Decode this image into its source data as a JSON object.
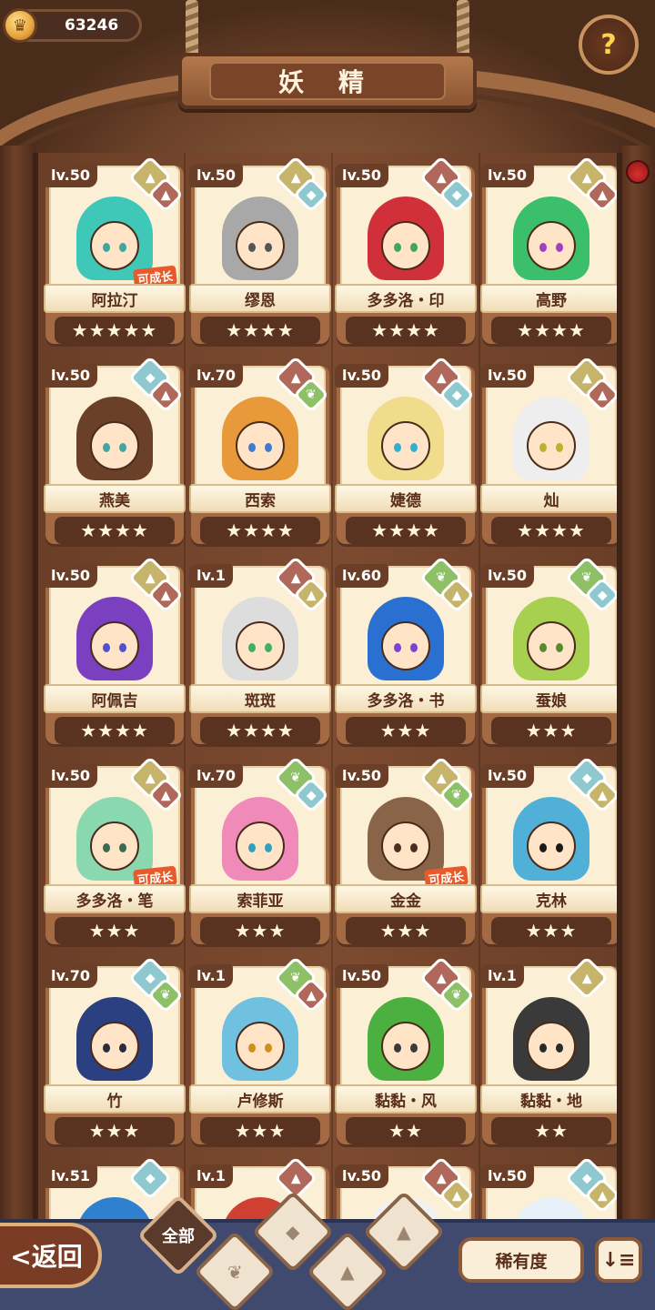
{
  "header": {
    "title": "妖 精",
    "coins": "63246",
    "coin_icon": "crown-coin-icon",
    "help_icon": "question-sprout-icon"
  },
  "cards": [
    {
      "level": "lv.50",
      "name": "阿拉汀",
      "stars": "★★★★★",
      "gems": [
        "earth",
        "fire"
      ],
      "grow": "可成长",
      "eye": "#3fa6a0",
      "hair": "#3fc7b8"
    },
    {
      "level": "lv.50",
      "name": "缪恩",
      "stars": "★★★★",
      "gems": [
        "earth",
        "water"
      ],
      "grow": "",
      "eye": "#555555",
      "hair": "#a8a8a8"
    },
    {
      "level": "lv.50",
      "name": "多多洛・印",
      "stars": "★★★★",
      "gems": [
        "fire",
        "water"
      ],
      "grow": "",
      "eye": "#3fa660",
      "hair": "#d0303a"
    },
    {
      "level": "lv.50",
      "name": "高野",
      "stars": "★★★★",
      "gems": [
        "earth",
        "fire"
      ],
      "grow": "",
      "eye": "#a040c0",
      "hair": "#3cbf6a"
    },
    {
      "level": "lv.50",
      "name": "燕美",
      "stars": "★★★★",
      "gems": [
        "water",
        "fire"
      ],
      "grow": "",
      "eye": "#3fa6a0",
      "hair": "#6a4028"
    },
    {
      "level": "lv.70",
      "name": "西索",
      "stars": "★★★★",
      "gems": [
        "fire",
        "wood"
      ],
      "grow": "",
      "eye": "#3f7ad0",
      "hair": "#e89a3a"
    },
    {
      "level": "lv.50",
      "name": "婕德",
      "stars": "★★★★",
      "gems": [
        "fire",
        "water"
      ],
      "grow": "",
      "eye": "#30b0d0",
      "hair": "#f0dc8a"
    },
    {
      "level": "lv.50",
      "name": "灿",
      "stars": "★★★★",
      "gems": [
        "earth",
        "fire"
      ],
      "grow": "",
      "eye": "#c0b030",
      "hair": "#eeeeee"
    },
    {
      "level": "lv.50",
      "name": "阿佩吉",
      "stars": "★★★★",
      "gems": [
        "earth",
        "fire"
      ],
      "grow": "",
      "eye": "#5050d0",
      "hair": "#7a40c0"
    },
    {
      "level": "lv.1",
      "name": "斑斑",
      "stars": "★★★★",
      "gems": [
        "fire",
        "earth"
      ],
      "grow": "",
      "eye": "#40b060",
      "hair": "#dddddd"
    },
    {
      "level": "lv.60",
      "name": "多多洛・书",
      "stars": "★★★",
      "gems": [
        "wood",
        "earth"
      ],
      "grow": "",
      "eye": "#8040d0",
      "hair": "#2a70d0"
    },
    {
      "level": "lv.50",
      "name": "蚕娘",
      "stars": "★★★",
      "gems": [
        "wood",
        "water"
      ],
      "grow": "",
      "eye": "#5a8a30",
      "hair": "#a8d050"
    },
    {
      "level": "lv.50",
      "name": "多多洛・笔",
      "stars": "★★★",
      "gems": [
        "earth",
        "fire"
      ],
      "grow": "可成长",
      "eye": "#3a6a50",
      "hair": "#8ad8b0"
    },
    {
      "level": "lv.70",
      "name": "索菲亚",
      "stars": "★★★",
      "gems": [
        "wood",
        "water"
      ],
      "grow": "",
      "eye": "#30a0c0",
      "hair": "#f08ab8"
    },
    {
      "level": "lv.50",
      "name": "金金",
      "stars": "★★★",
      "gems": [
        "earth",
        "wood"
      ],
      "grow": "可成长",
      "eye": "#4a3020",
      "hair": "#8a6448"
    },
    {
      "level": "lv.50",
      "name": "克林",
      "stars": "★★★",
      "gems": [
        "water",
        "earth"
      ],
      "grow": "",
      "eye": "#1a1a1a",
      "hair": "#50b0d8"
    },
    {
      "level": "lv.70",
      "name": "竹",
      "stars": "★★★",
      "gems": [
        "water",
        "wood"
      ],
      "grow": "",
      "eye": "#2a2a40",
      "hair": "#2a4080"
    },
    {
      "level": "lv.1",
      "name": "卢修斯",
      "stars": "★★★",
      "gems": [
        "wood",
        "fire"
      ],
      "grow": "",
      "eye": "#d09020",
      "hair": "#70c0e0"
    },
    {
      "level": "lv.50",
      "name": "黏黏・风",
      "stars": "★★",
      "gems": [
        "fire",
        "wood"
      ],
      "grow": "",
      "eye": "#3a3a3a",
      "hair": "#4cb040"
    },
    {
      "level": "lv.1",
      "name": "黏黏・地",
      "stars": "★★",
      "gems": [
        "earth"
      ],
      "grow": "",
      "eye": "#2a2a2a",
      "hair": "#3a3a3a"
    },
    {
      "level": "lv.51",
      "name": "",
      "stars": "",
      "gems": [
        "water"
      ],
      "grow": "",
      "eye": "#2a2a2a",
      "hair": "#3080d0"
    },
    {
      "level": "lv.1",
      "name": "",
      "stars": "",
      "gems": [
        "fire"
      ],
      "grow": "",
      "eye": "#2a2a2a",
      "hair": "#d04030"
    },
    {
      "level": "lv.50",
      "name": "",
      "stars": "",
      "gems": [
        "fire",
        "earth"
      ],
      "grow": "",
      "eye": "#2a2a2a",
      "hair": "#f0f0f0"
    },
    {
      "level": "lv.50",
      "name": "",
      "stars": "",
      "gems": [
        "water",
        "earth"
      ],
      "grow": "",
      "eye": "#2a2a2a",
      "hair": "#e8f0f8"
    }
  ],
  "bottom": {
    "back_label": "<返回",
    "filter_all": "全部",
    "filter_icons": [
      "sprout-icon",
      "droplet-icon",
      "mountain-icon",
      "volcano-icon"
    ],
    "rarity_label": "稀有度",
    "sort_glyph": "↓≡"
  },
  "colors": {
    "earth": "#c7b46b",
    "fire": "#b0685a",
    "water": "#8fc9cf",
    "wood": "#8dc067"
  }
}
